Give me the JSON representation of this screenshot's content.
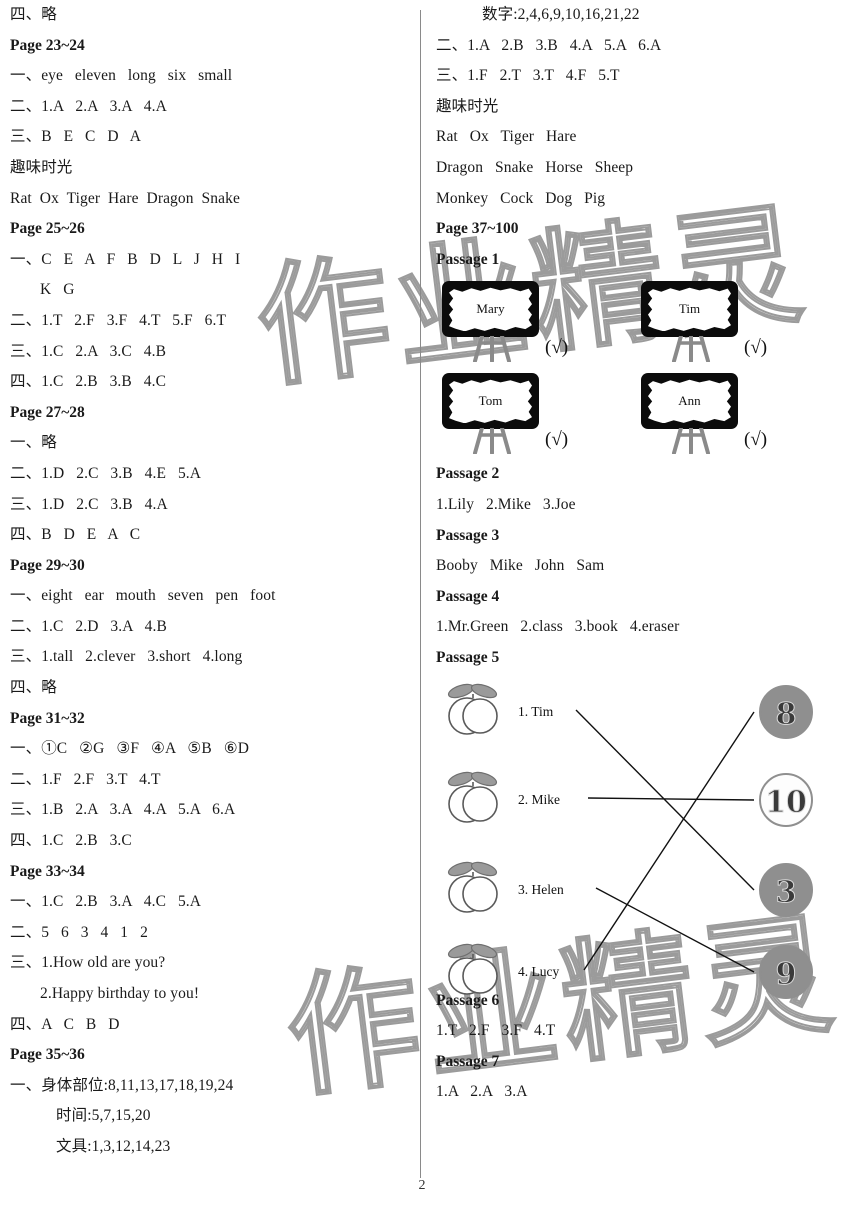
{
  "page": {
    "number": "2",
    "watermark": "作业精灵"
  },
  "left_column": [
    {
      "type": "line",
      "text": "四、略"
    },
    {
      "type": "hdr",
      "text": "Page 23~24"
    },
    {
      "type": "line",
      "text": "一、eye   eleven   long   six   small"
    },
    {
      "type": "line",
      "text": "二、1.A   2.A   3.A   4.A"
    },
    {
      "type": "line",
      "text": "三、B   E   C   D   A"
    },
    {
      "type": "line",
      "text": "趣味时光"
    },
    {
      "type": "line",
      "text": "Rat  Ox  Tiger  Hare  Dragon  Snake"
    },
    {
      "type": "hdr",
      "text": "Page 25~26"
    },
    {
      "type": "line",
      "text": "一、C   E   A   F   B   D   L   J   H   I"
    },
    {
      "type": "indent",
      "text": "K   G"
    },
    {
      "type": "line",
      "text": "二、1.T   2.F   3.F   4.T   5.F   6.T"
    },
    {
      "type": "line",
      "text": "三、1.C   2.A   3.C   4.B"
    },
    {
      "type": "line",
      "text": "四、1.C   2.B   3.B   4.C"
    },
    {
      "type": "hdr",
      "text": "Page 27~28"
    },
    {
      "type": "line",
      "text": "一、略"
    },
    {
      "type": "line",
      "text": "二、1.D   2.C   3.B   4.E   5.A"
    },
    {
      "type": "line",
      "text": "三、1.D   2.C   3.B   4.A"
    },
    {
      "type": "line",
      "text": "四、B   D   E   A   C"
    },
    {
      "type": "hdr",
      "text": "Page 29~30"
    },
    {
      "type": "line",
      "text": "一、eight   ear   mouth   seven   pen   foot"
    },
    {
      "type": "line",
      "text": "二、1.C   2.D   3.A   4.B"
    },
    {
      "type": "line",
      "text": "三、1.tall   2.clever   3.short   4.long"
    },
    {
      "type": "line",
      "text": "四、略"
    },
    {
      "type": "hdr",
      "text": "Page 31~32"
    },
    {
      "type": "line",
      "text": "一、①C   ②G   ③F   ④A   ⑤B   ⑥D"
    },
    {
      "type": "line",
      "text": "二、1.F   2.F   3.T   4.T"
    },
    {
      "type": "line",
      "text": "三、1.B   2.A   3.A   4.A   5.A   6.A"
    },
    {
      "type": "line",
      "text": "四、1.C   2.B   3.C"
    },
    {
      "type": "hdr",
      "text": "Page 33~34"
    },
    {
      "type": "line",
      "text": "一、1.C   2.B   3.A   4.C   5.A"
    },
    {
      "type": "line",
      "text": "二、5   6   3   4   1   2"
    },
    {
      "type": "line",
      "text": "三、1.How old are you?"
    },
    {
      "type": "indent",
      "text": "2.Happy birthday to you!"
    },
    {
      "type": "line",
      "text": "四、A   C   B   D"
    },
    {
      "type": "hdr",
      "text": "Page 35~36"
    },
    {
      "type": "line",
      "text": "一、身体部位:8,11,13,17,18,19,24"
    },
    {
      "type": "indent2",
      "text": "时间:5,7,15,20"
    },
    {
      "type": "indent2",
      "text": "文具:1,3,12,14,23"
    }
  ],
  "right_column": {
    "top_lines": [
      {
        "type": "indent2",
        "text": "数字:2,4,6,9,10,16,21,22"
      },
      {
        "type": "line",
        "text": "二、1.A   2.B   3.B   4.A   5.A   6.A"
      },
      {
        "type": "line",
        "text": "三、1.F   2.T   3.T   4.F   5.T"
      },
      {
        "type": "line",
        "text": "趣味时光"
      },
      {
        "type": "line",
        "text": "Rat   Ox   Tiger   Hare"
      },
      {
        "type": "line",
        "text": "Dragon   Snake   Horse   Sheep"
      },
      {
        "type": "line",
        "text": "Monkey   Cock   Dog   Pig"
      }
    ],
    "page_heading": "Page 37~100",
    "passages": [
      {
        "title": "Passage 1",
        "kind": "boards",
        "items": [
          {
            "name": "Mary",
            "mark": "(√)"
          },
          {
            "name": "Tim",
            "mark": "(√)"
          },
          {
            "name": "Tom",
            "mark": "(√)"
          },
          {
            "name": "Ann",
            "mark": "(√)"
          }
        ]
      },
      {
        "title": "Passage 2",
        "kind": "text",
        "lines": [
          "1.Lily   2.Mike   3.Joe"
        ]
      },
      {
        "title": "Passage 3",
        "kind": "text",
        "lines": [
          "Booby   Mike   John   Sam"
        ]
      },
      {
        "title": "Passage 4",
        "kind": "text",
        "lines": [
          "1.Mr.Green   2.class   3.book   4.eraser"
        ]
      },
      {
        "title": "Passage 5",
        "kind": "matching",
        "names": [
          "1. Tim",
          "2. Mike",
          "3. Helen",
          "4. Lucy"
        ],
        "numbers": [
          "8",
          "10",
          "3",
          "9"
        ],
        "connections": [
          {
            "from": 0,
            "to": 2
          },
          {
            "from": 1,
            "to": 1
          },
          {
            "from": 2,
            "to": 3
          },
          {
            "from": 3,
            "to": 0
          }
        ]
      },
      {
        "title": "Passage 6",
        "kind": "text",
        "lines": [
          "1.T   2.F   3.F   4.T"
        ]
      },
      {
        "title": "Passage 7",
        "kind": "text",
        "lines": [
          "1.A   2.A   3.A"
        ]
      }
    ]
  },
  "colors": {
    "ink": "#1a1a1a",
    "divider": "#8a8a8a",
    "watermark": "#9b9b9b",
    "board": "#0b0b0b",
    "circle_fill": "#8f8f8f",
    "leaf": "#9a9a9a"
  }
}
